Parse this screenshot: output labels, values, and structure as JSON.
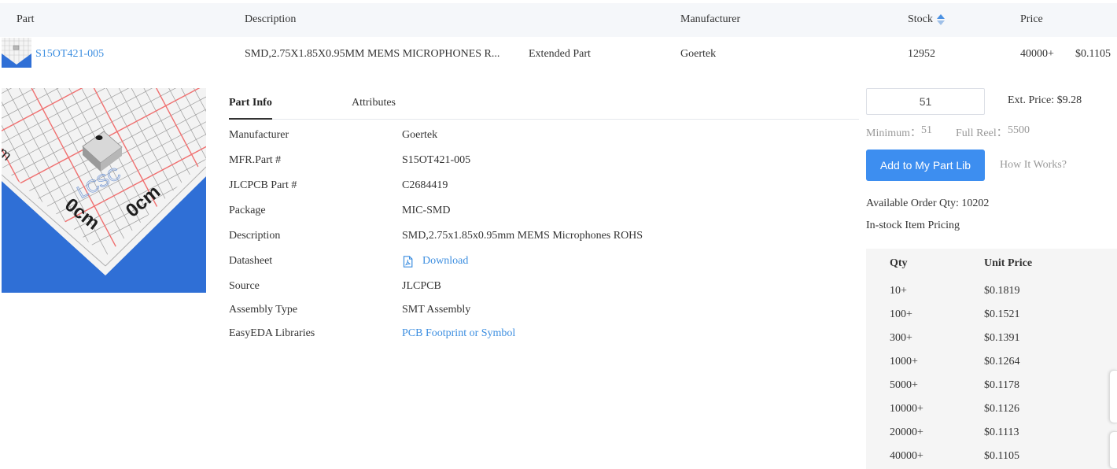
{
  "header": {
    "part": "Part",
    "description": "Description",
    "manufacturer": "Manufacturer",
    "stock": "Stock",
    "price": "Price"
  },
  "row": {
    "part_number": "S15OT421-005",
    "description": "SMD,2.75X1.85X0.95MM MEMS MICROPHONES R...",
    "part_type": "Extended Part",
    "manufacturer": "Goertek",
    "stock": "12952",
    "price_qty": "40000+",
    "price": "$0.1105"
  },
  "tabs": [
    {
      "label": "Part Info",
      "active": true
    },
    {
      "label": "Attributes",
      "active": false
    }
  ],
  "part_info": [
    {
      "label": "Manufacturer",
      "value": "Goertek"
    },
    {
      "label": "MFR.Part #",
      "value": "S15OT421-005"
    },
    {
      "label": "JLCPCB Part #",
      "value": "C2684419"
    },
    {
      "label": "Package",
      "value": "MIC-SMD"
    },
    {
      "label": "Description",
      "value": "SMD,2.75x1.85x0.95mm MEMS Microphones ROHS"
    },
    {
      "label": "Datasheet",
      "value": "Download",
      "icon": "pdf-icon"
    },
    {
      "label": "Source",
      "value": "JLCPCB"
    },
    {
      "label": "Assembly Type",
      "value": "SMT Assembly"
    },
    {
      "label": "EasyEDA Libraries",
      "value": "PCB Footprint or Symbol"
    }
  ],
  "order": {
    "quantity": "51",
    "ext_price": "Ext. Price: $9.28",
    "minimum_label": "Minimum：",
    "minimum_value": "51",
    "full_reel_label": "Full Reel：",
    "full_reel_value": "5500",
    "add_button": "Add to My Part Lib",
    "how_it_works": "How It Works?",
    "available": "Available Order Qty: 10202",
    "pricing_title": "In-stock Item Pricing"
  },
  "pricing": {
    "qty_header": "Qty",
    "unit_price_header": "Unit Price",
    "rows": [
      {
        "qty": "10+",
        "price": "$0.1819"
      },
      {
        "qty": "100+",
        "price": "$0.1521"
      },
      {
        "qty": "300+",
        "price": "$0.1391"
      },
      {
        "qty": "1000+",
        "price": "$0.1264"
      },
      {
        "qty": "5000+",
        "price": "$0.1178"
      },
      {
        "qty": "10000+",
        "price": "$0.1126"
      },
      {
        "qty": "20000+",
        "price": "$0.1113"
      },
      {
        "qty": "40000+",
        "price": "$0.1105"
      }
    ]
  },
  "image_marks": [
    "0cm",
    "0cm",
    "LCSC"
  ],
  "colors": {
    "link": "#3c8ee0",
    "button": "#3d8ef0",
    "header_bg": "#f5f7fa",
    "table_bg": "#f5f5f5",
    "sort_up": "#4a90e2",
    "sort_down": "#9fc0e8"
  }
}
